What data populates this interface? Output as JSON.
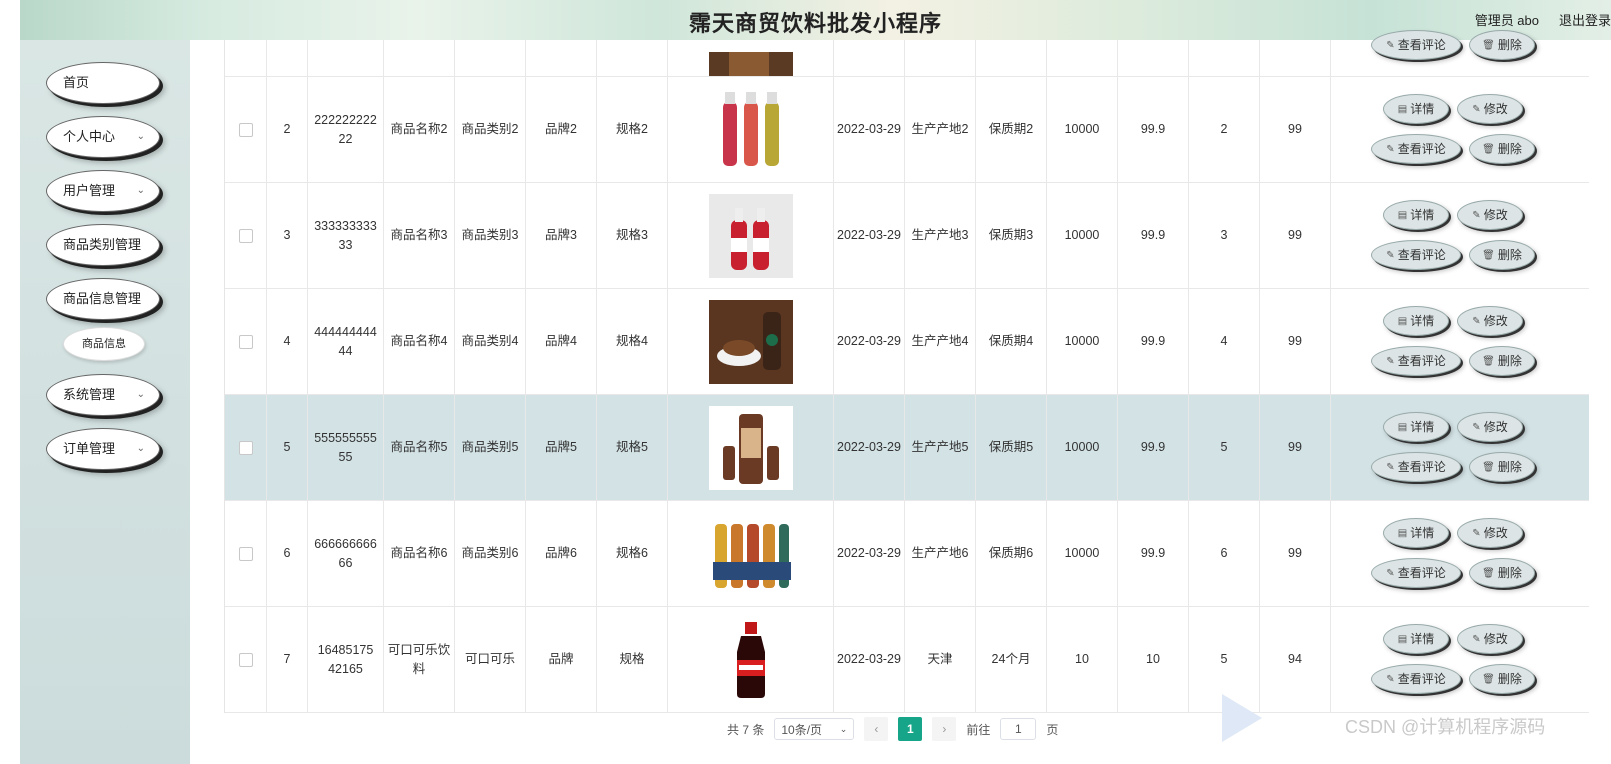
{
  "header": {
    "title": "霈天商贸饮料批发小程序",
    "user": "管理员 abo",
    "logout": "退出登录"
  },
  "sidebar": {
    "items": [
      {
        "label": "首页"
      },
      {
        "label": "个人中心"
      },
      {
        "label": "用户管理"
      },
      {
        "label": "商品类别管理"
      },
      {
        "label": "商品信息管理"
      },
      {
        "label": "系统管理"
      },
      {
        "label": "订单管理"
      }
    ],
    "sub_item": "商品信息"
  },
  "actions": {
    "detail": "详情",
    "edit": "修改",
    "review": "查看评论",
    "delete": "删除"
  },
  "rows": [
    {
      "idx": "2",
      "no": "222222222 22",
      "name": "商品名称2",
      "cat": "商品类别2",
      "brand": "品牌2",
      "spec": "规格2",
      "date": "2022-03-29",
      "origin": "生产产地2",
      "shelf": "保质期2",
      "stock": "10000",
      "price": "99.9",
      "clicks": "2",
      "total": "99"
    },
    {
      "idx": "3",
      "no": "333333333 33",
      "name": "商品名称3",
      "cat": "商品类别3",
      "brand": "品牌3",
      "spec": "规格3",
      "date": "2022-03-29",
      "origin": "生产产地3",
      "shelf": "保质期3",
      "stock": "10000",
      "price": "99.9",
      "clicks": "3",
      "total": "99"
    },
    {
      "idx": "4",
      "no": "444444444 44",
      "name": "商品名称4",
      "cat": "商品类别4",
      "brand": "品牌4",
      "spec": "规格4",
      "date": "2022-03-29",
      "origin": "生产产地4",
      "shelf": "保质期4",
      "stock": "10000",
      "price": "99.9",
      "clicks": "4",
      "total": "99"
    },
    {
      "idx": "5",
      "no": "555555555 55",
      "name": "商品名称5",
      "cat": "商品类别5",
      "brand": "品牌5",
      "spec": "规格5",
      "date": "2022-03-29",
      "origin": "生产产地5",
      "shelf": "保质期5",
      "stock": "10000",
      "price": "99.9",
      "clicks": "5",
      "total": "99"
    },
    {
      "idx": "6",
      "no": "666666666 66",
      "name": "商品名称6",
      "cat": "商品类别6",
      "brand": "品牌6",
      "spec": "规格6",
      "date": "2022-03-29",
      "origin": "生产产地6",
      "shelf": "保质期6",
      "stock": "10000",
      "price": "99.9",
      "clicks": "6",
      "total": "99"
    },
    {
      "idx": "7",
      "no": "16485175 42165",
      "name": "可口可乐饮料",
      "cat": "可口可乐",
      "brand": "品牌",
      "spec": "规格",
      "date": "2022-03-29",
      "origin": "天津",
      "shelf": "24个月",
      "stock": "10",
      "price": "10",
      "clicks": "5",
      "total": "94"
    }
  ],
  "pagination": {
    "total": "共 7 条",
    "page_size": "10条/页",
    "prev": "‹",
    "current": "1",
    "next": "›",
    "goto": "前往",
    "goto_value": "1",
    "page_unit": "页"
  },
  "watermark": "CSDN @计算机程序源码",
  "colors": {
    "accent": "#17a589",
    "highlight_row": "#d3e2e5",
    "sidebar": "#d9e6e4"
  }
}
